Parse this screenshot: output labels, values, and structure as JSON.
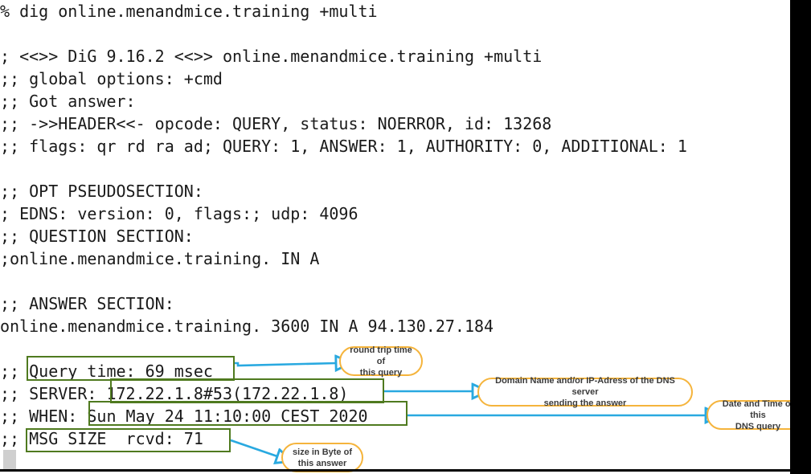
{
  "colors": {
    "background": "#ffffff",
    "terminal_text": "#1a1a1a",
    "highlight_box_border": "#4f7a1f",
    "arrow": "#29a9e0",
    "callout_border": "#f5b43c",
    "callout_text": "#3b3b3b",
    "slide_edge": "#000000",
    "cursor_block": "#cfcfcf"
  },
  "terminal": {
    "lines": [
      {
        "id": "prompt-command",
        "text": "% dig online.menandmice.training +multi"
      },
      {
        "id": "blank-1",
        "text": ""
      },
      {
        "id": "dig-version",
        "text": "; <<>> DiG 9.16.2 <<>> online.menandmice.training +multi"
      },
      {
        "id": "global-options",
        "text": ";; global options: +cmd"
      },
      {
        "id": "got-answer",
        "text": ";; Got answer:"
      },
      {
        "id": "header",
        "text": ";; ->>HEADER<<- opcode: QUERY, status: NOERROR, id: 13268"
      },
      {
        "id": "flags",
        "text": ";; flags: qr rd ra ad; QUERY: 1, ANSWER: 1, AUTHORITY: 0, ADDITIONAL: 1"
      },
      {
        "id": "blank-2",
        "text": ""
      },
      {
        "id": "opt-pseudosection",
        "text": ";; OPT PSEUDOSECTION:"
      },
      {
        "id": "edns",
        "text": "; EDNS: version: 0, flags:; udp: 4096"
      },
      {
        "id": "question-section",
        "text": ";; QUESTION SECTION:"
      },
      {
        "id": "question-record",
        "text": ";online.menandmice.training. IN A"
      },
      {
        "id": "blank-3",
        "text": ""
      },
      {
        "id": "answer-section",
        "text": ";; ANSWER SECTION:"
      },
      {
        "id": "answer-record",
        "text": "online.menandmice.training. 3600 IN A 94.130.27.184"
      },
      {
        "id": "blank-4",
        "text": ""
      },
      {
        "id": "query-time",
        "text": ";; Query time: 69 msec"
      },
      {
        "id": "server",
        "text": ";; SERVER: 172.22.1.8#53(172.22.1.8)"
      },
      {
        "id": "when",
        "text": ";; WHEN: Sun May 24 11:10:00 CEST 2020"
      },
      {
        "id": "msg-size",
        "text": ";; MSG SIZE  rcvd: 71"
      }
    ]
  },
  "highlights": [
    {
      "id": "query-time-box",
      "label": "Query time: 69 msec"
    },
    {
      "id": "server-box",
      "label": "172.22.1.8#53(172.22.1.8)"
    },
    {
      "id": "when-box",
      "label": "Sun May 24 11:10:00 CEST 2020"
    },
    {
      "id": "msg-size-box",
      "label": "MSG SIZE  rcvd: 71"
    }
  ],
  "callouts": [
    {
      "id": "query-time-callout",
      "line1": "round trip time of",
      "line2": "this query"
    },
    {
      "id": "server-callout",
      "line1": "Domain Name and/or IP-Adress of the DNS server",
      "line2": "sending the answer"
    },
    {
      "id": "when-callout",
      "line1": "Date and Time of this",
      "line2": "DNS query"
    },
    {
      "id": "msg-size-callout",
      "line1": "size in Byte of",
      "line2": "this answer"
    }
  ]
}
